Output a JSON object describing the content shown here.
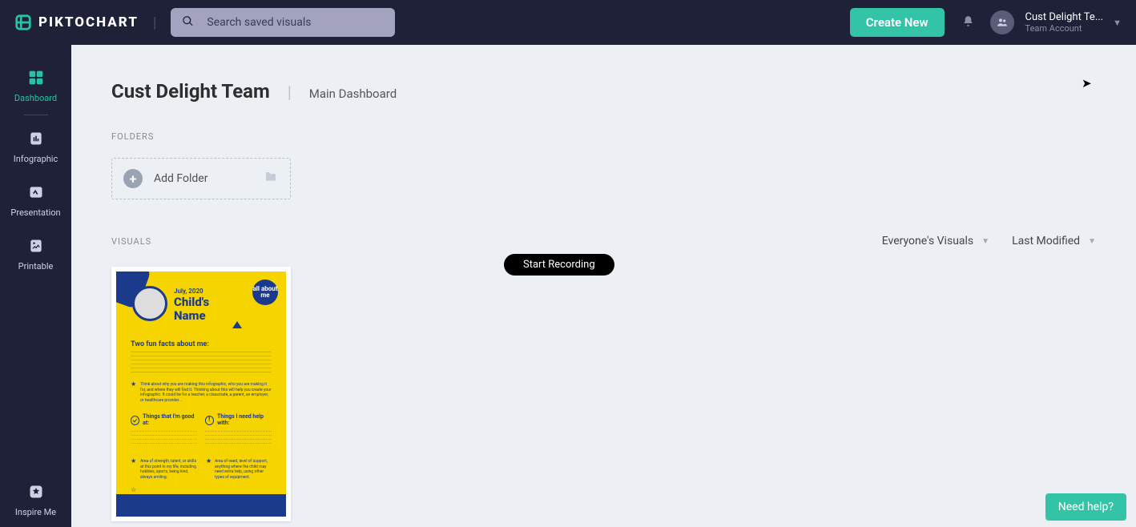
{
  "header": {
    "logo_text": "PIKTOCHART",
    "search_placeholder": "Search saved visuals",
    "create_label": "Create New",
    "user_name": "Cust Delight Te...",
    "user_sub": "Team Account"
  },
  "sidebar": {
    "items": [
      {
        "label": "Dashboard",
        "active": true
      },
      {
        "label": "Infographic",
        "active": false
      },
      {
        "label": "Presentation",
        "active": false
      },
      {
        "label": "Printable",
        "active": false
      }
    ],
    "bottom": {
      "label": "Inspire Me"
    }
  },
  "main": {
    "team_title": "Cust Delight Team",
    "breadcrumb": "Main Dashboard",
    "folders_label": "FOLDERS",
    "add_folder_label": "Add Folder",
    "visuals_label": "VISUALS",
    "filter_owner": "Everyone's Visuals",
    "sort_by": "Last Modified",
    "visual": {
      "date": "July, 2020",
      "title_line1": "Child's",
      "title_line2": "Name",
      "badge": "all about me",
      "funfacts": "Two fun facts about me:",
      "good_at": "Things that I'm good at:",
      "help_with": "Things I need help with:"
    }
  },
  "tooltip": "Start Recording",
  "help": "Need help?"
}
